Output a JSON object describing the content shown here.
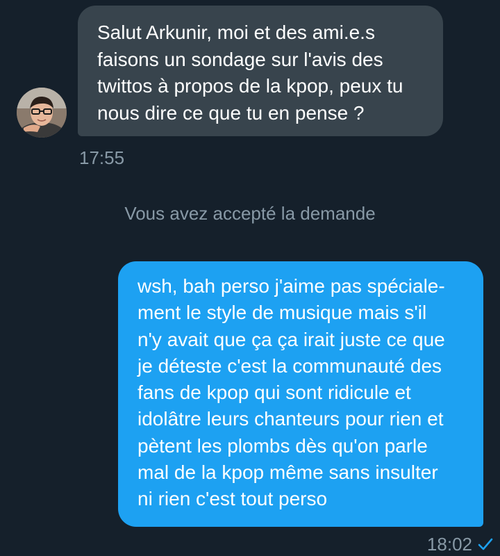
{
  "received": {
    "text": "Salut Arkunir, moi et des ami.e.s\nfaisons un sondage sur l'avis des\ntwittos à propos de la kpop, peux tu\nnous dire ce que tu en pense ?",
    "time": "17:55"
  },
  "notice": "Vous avez accepté la demande",
  "sent": {
    "text": "wsh, bah perso j'aime pas spéciale-\nment le style de musique mais s'il\nn'y avait que ça ça irait juste ce que\nje déteste c'est la communauté des\nfans de kpop qui sont ridicule et\nidolâtre leurs chanteurs pour rien et\npètent les plombs dès qu'on parle\nmal de la kpop même sans insulter\nni rien c'est tout perso",
    "time": "18:02",
    "status_icon": "check-icon"
  },
  "colors": {
    "background": "#15202b",
    "received_bubble": "#38444d",
    "sent_bubble": "#1da1f2",
    "muted_text": "#8899a6"
  }
}
